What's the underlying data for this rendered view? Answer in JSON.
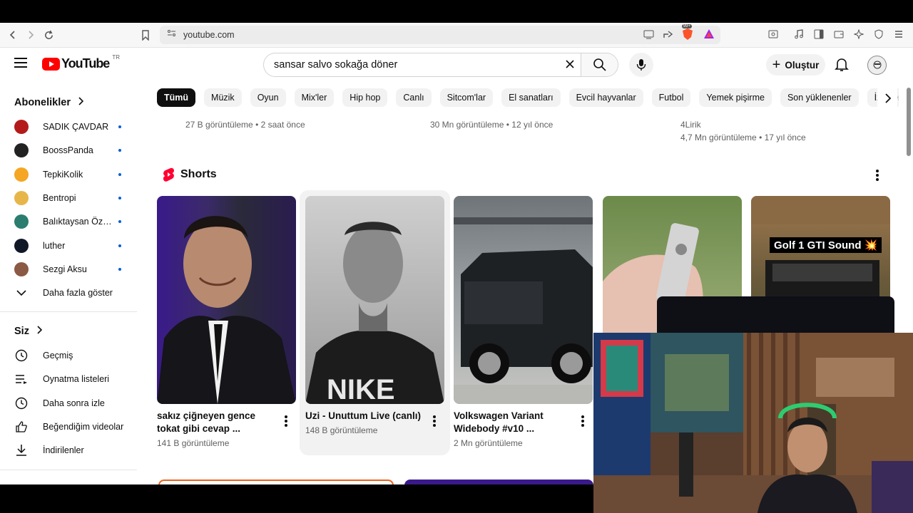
{
  "browser": {
    "url": "youtube.com",
    "ext_badge": "99+"
  },
  "masthead": {
    "logo_text": "YouTube",
    "country": "TR",
    "search_query": "sansar salvo sokağa döner",
    "create_label": "Oluştur"
  },
  "sidebar": {
    "subscriptions_title": "Abonelikler",
    "subscriptions": [
      {
        "name": "SADIK ÇAVDAR",
        "color": "#b31b1b"
      },
      {
        "name": "BoossPanda",
        "color": "#222222"
      },
      {
        "name": "TepkiKolik",
        "color": "#f5a623"
      },
      {
        "name": "Bentropi",
        "color": "#e7b64a"
      },
      {
        "name": "Balıktaysan Özg...",
        "color": "#2a7d6f"
      },
      {
        "name": "luther",
        "color": "#101828"
      },
      {
        "name": "Sezgi Aksu",
        "color": "#8a5a44"
      }
    ],
    "show_more": "Daha fazla göster",
    "you_title": "Siz",
    "you_items": [
      {
        "label": "Geçmiş",
        "icon": "history-icon"
      },
      {
        "label": "Oynatma listeleri",
        "icon": "playlist-icon"
      },
      {
        "label": "Daha sonra izle",
        "icon": "watch-later-icon"
      },
      {
        "label": "Beğendiğim videolar",
        "icon": "like-icon"
      },
      {
        "label": "İndirilenler",
        "icon": "download-icon"
      }
    ]
  },
  "chips": [
    "Tümü",
    "Müzik",
    "Oyun",
    "Mix'ler",
    "Hip hop",
    "Canlı",
    "Sitcom'lar",
    "El sanatları",
    "Evcil hayvanlar",
    "Futbol",
    "Yemek pişirme",
    "Son yüklenenler",
    "İzlenenler"
  ],
  "prev_results": [
    {
      "meta": "27 B görüntüleme • 2 saat önce"
    },
    {
      "meta": "30 Mn görüntüleme • 12 yıl önce"
    },
    {
      "channel": "4Lirik",
      "meta": "4,7 Mn görüntüleme • 17 yıl önce"
    }
  ],
  "shorts": {
    "title": "Shorts",
    "items": [
      {
        "title": "sakız çiğneyen gence tokat gibi cevap ...",
        "views": "141 B görüntüleme"
      },
      {
        "title": "Uzi - Unuttum Live (canlı)",
        "views": "148 B görüntüleme"
      },
      {
        "title": "Volkswagen Variant Widebody #v10 ...",
        "views": "2 Mn görüntüleme"
      },
      {
        "title": "",
        "views": ""
      },
      {
        "title": "",
        "views": "",
        "overlay_text": "Golf 1 GTI Sound 💥"
      }
    ]
  }
}
